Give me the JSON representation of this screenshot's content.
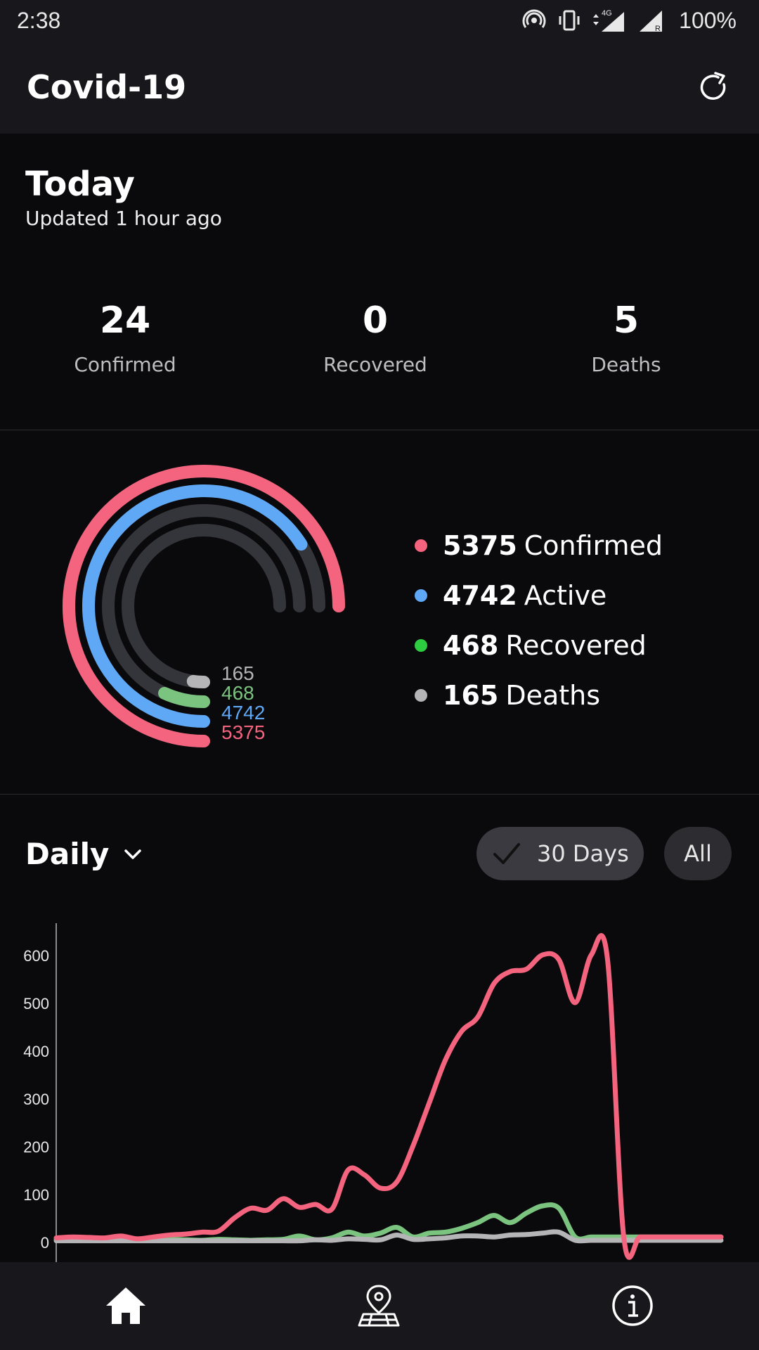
{
  "status_bar": {
    "time": "2:38",
    "battery": "100%"
  },
  "app_bar": {
    "title": "Covid-19"
  },
  "today": {
    "title": "Today",
    "updated": "Updated 1 hour ago",
    "stats": [
      {
        "value": "24",
        "label": "Confirmed"
      },
      {
        "value": "0",
        "label": "Recovered"
      },
      {
        "value": "5",
        "label": "Deaths"
      }
    ]
  },
  "summary": {
    "rings": [
      {
        "label": "5375",
        "color": "#f5647f",
        "fraction": 1.0
      },
      {
        "label": "4742",
        "color": "#5ea8f5",
        "fraction": 0.88
      },
      {
        "label": "468",
        "color": "#7bc47f",
        "fraction": 0.09
      },
      {
        "label": "165",
        "color": "#b5b5b8",
        "fraction": 0.03
      }
    ],
    "legend": [
      {
        "value": "5375",
        "label": "Confirmed",
        "color": "#f5647f"
      },
      {
        "value": "4742",
        "label": "Active",
        "color": "#5ea8f5"
      },
      {
        "value": "468",
        "label": "Recovered",
        "color": "#2ecc40"
      },
      {
        "value": "165",
        "label": "Deaths",
        "color": "#b5b5b8"
      }
    ]
  },
  "daily": {
    "selector_label": "Daily",
    "chips": {
      "thirty_days": "30 Days",
      "all": "All"
    }
  },
  "chart_data": {
    "type": "line",
    "ylim": [
      0,
      650
    ],
    "yticks": [
      0,
      100,
      200,
      300,
      400,
      500,
      600
    ],
    "x": [
      1,
      2,
      3,
      4,
      5,
      6,
      7,
      8,
      9,
      10,
      11,
      12,
      13,
      14,
      15,
      16,
      17,
      18,
      19,
      20,
      21,
      22,
      23,
      24,
      25,
      26,
      27,
      28,
      29,
      30,
      31,
      32,
      33,
      34,
      35,
      36,
      37,
      38,
      39,
      40,
      41,
      42
    ],
    "series": [
      {
        "color": "#f5647f",
        "values": [
          8,
          10,
          9,
          8,
          12,
          6,
          10,
          14,
          16,
          20,
          22,
          50,
          70,
          66,
          90,
          72,
          78,
          68,
          150,
          140,
          112,
          125,
          200,
          290,
          380,
          440,
          470,
          540,
          565,
          570,
          600,
          590,
          500,
          600,
          590,
          10,
          10,
          10,
          10,
          10,
          10,
          10
        ]
      },
      {
        "color": "#7bc47f",
        "values": [
          5,
          5,
          6,
          4,
          5,
          3,
          4,
          5,
          4,
          3,
          5,
          4,
          3,
          4,
          5,
          12,
          4,
          8,
          20,
          12,
          18,
          30,
          10,
          18,
          20,
          28,
          40,
          55,
          40,
          60,
          75,
          70,
          10,
          10,
          10,
          10,
          10,
          10,
          10,
          10,
          10,
          10
        ]
      },
      {
        "color": "#b5b5b8",
        "values": [
          2,
          2,
          2,
          2,
          2,
          2,
          2,
          2,
          2,
          2,
          2,
          2,
          2,
          2,
          2,
          2,
          4,
          3,
          6,
          5,
          4,
          14,
          5,
          6,
          8,
          12,
          12,
          10,
          14,
          15,
          18,
          20,
          3,
          3,
          3,
          3,
          3,
          3,
          3,
          3,
          3,
          3
        ]
      }
    ]
  },
  "nav": {
    "items": [
      "home-icon",
      "map-icon",
      "info-icon"
    ],
    "active": "home-icon"
  }
}
